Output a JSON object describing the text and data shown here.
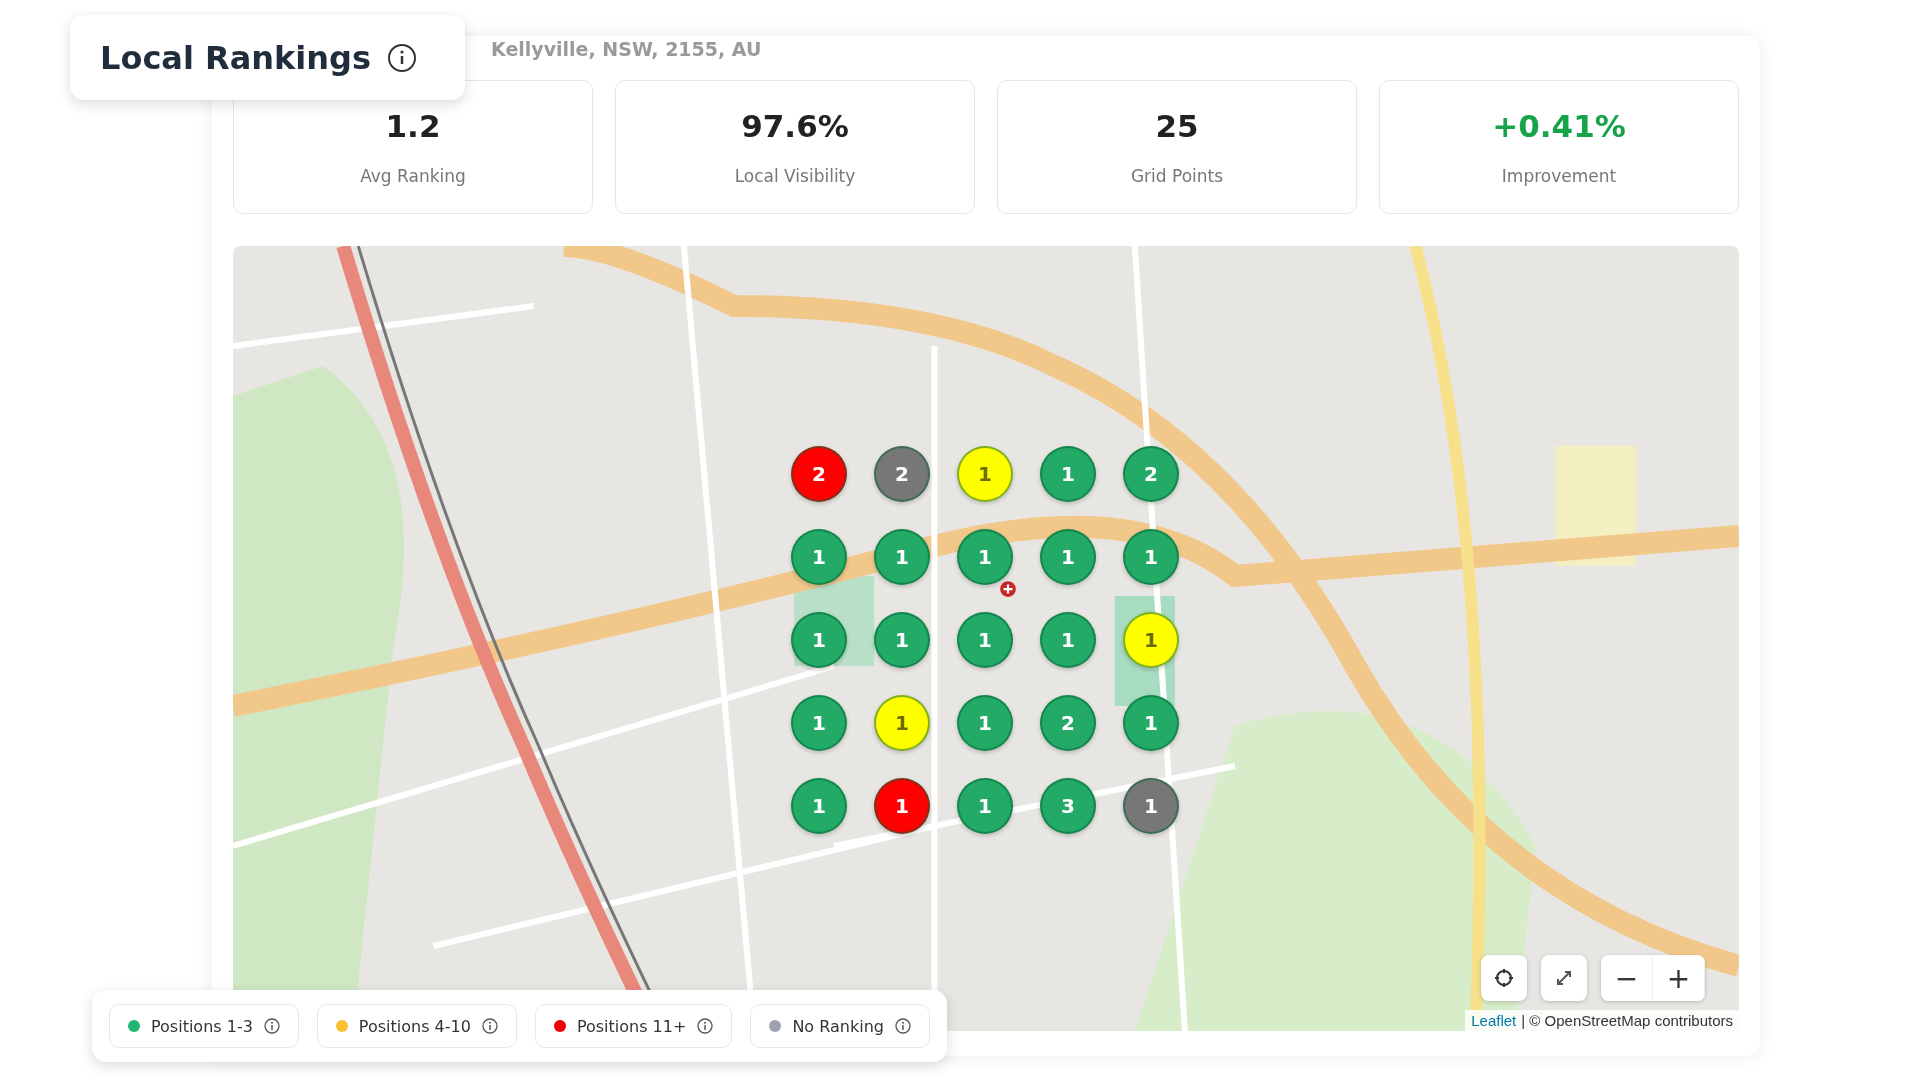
{
  "header": {
    "title": "Local Rankings",
    "address": "Kellyville, NSW, 2155, AU"
  },
  "stats": [
    {
      "value": "1.2",
      "label": "Avg Ranking",
      "positive": false
    },
    {
      "value": "97.6%",
      "label": "Local Visibility",
      "positive": false
    },
    {
      "value": "25",
      "label": "Grid Points",
      "positive": false
    },
    {
      "value": "+0.41%",
      "label": "Improvement",
      "positive": true
    }
  ],
  "grid_points": [
    {
      "rank": "2",
      "color": "#ff0000"
    },
    {
      "rank": "2",
      "color": "#777777"
    },
    {
      "rank": "1",
      "color": "#ffff00"
    },
    {
      "rank": "1",
      "color": "#22aa66"
    },
    {
      "rank": "2",
      "color": "#22aa66"
    },
    {
      "rank": "1",
      "color": "#22aa66"
    },
    {
      "rank": "1",
      "color": "#22aa66"
    },
    {
      "rank": "1",
      "color": "#22aa66"
    },
    {
      "rank": "1",
      "color": "#22aa66"
    },
    {
      "rank": "1",
      "color": "#22aa66"
    },
    {
      "rank": "1",
      "color": "#22aa66"
    },
    {
      "rank": "1",
      "color": "#22aa66"
    },
    {
      "rank": "1",
      "color": "#22aa66"
    },
    {
      "rank": "1",
      "color": "#22aa66"
    },
    {
      "rank": "1",
      "color": "#ffff00"
    },
    {
      "rank": "1",
      "color": "#22aa66"
    },
    {
      "rank": "1",
      "color": "#ffff00"
    },
    {
      "rank": "1",
      "color": "#22aa66"
    },
    {
      "rank": "2",
      "color": "#22aa66"
    },
    {
      "rank": "1",
      "color": "#22aa66"
    },
    {
      "rank": "1",
      "color": "#22aa66"
    },
    {
      "rank": "1",
      "color": "#ff0000"
    },
    {
      "rank": "1",
      "color": "#22aa66"
    },
    {
      "rank": "3",
      "color": "#22aa66"
    },
    {
      "rank": "1",
      "color": "#777777"
    }
  ],
  "map_controls": {
    "zoom_out": "−",
    "zoom_in": "+"
  },
  "attribution": {
    "link": "Leaflet",
    "text": "| © OpenStreetMap contributors"
  },
  "legend": [
    {
      "label": "Positions 1-3",
      "color": "#22b573"
    },
    {
      "label": "Positions 4-10",
      "color": "#fbc02d"
    },
    {
      "label": "Positions 11+",
      "color": "#ee0000"
    },
    {
      "label": "No Ranking",
      "color": "#9ca3af"
    }
  ]
}
